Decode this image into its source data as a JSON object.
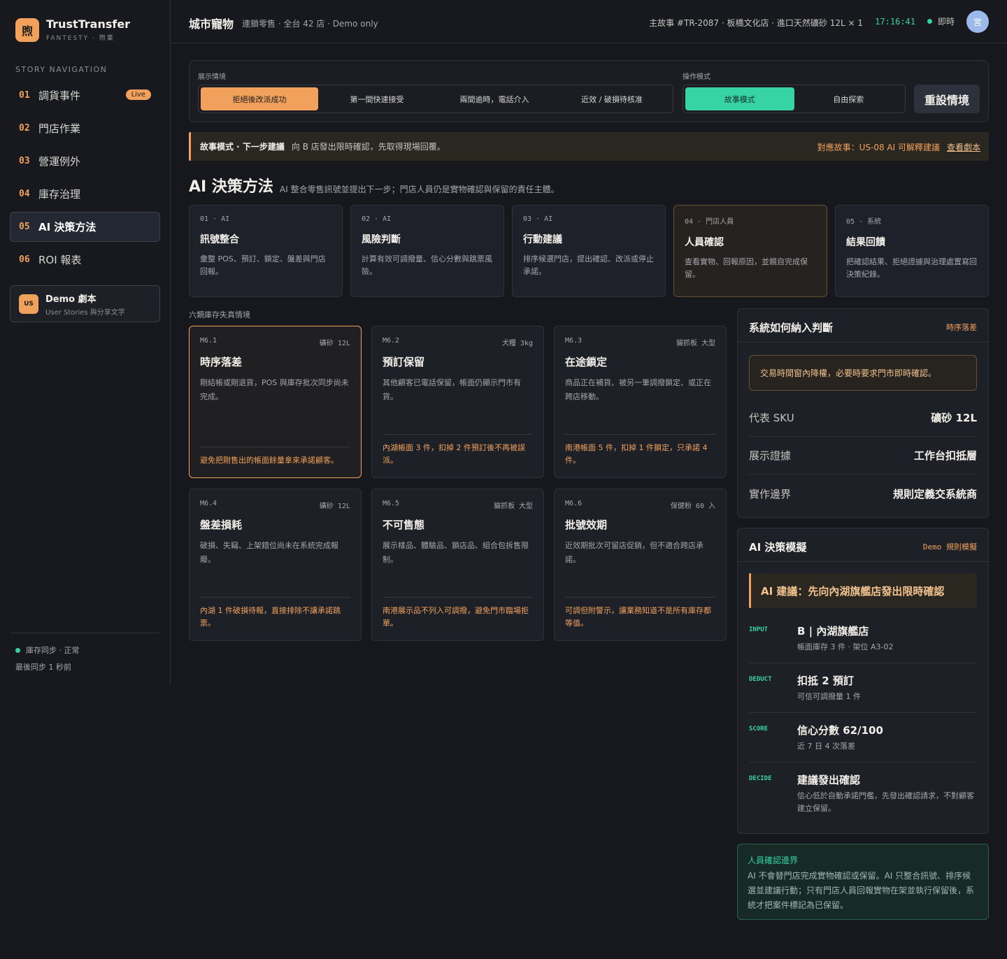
{
  "brand": {
    "logo_char": "煦",
    "name": "TrustTransfer",
    "sub": "FANTESTY · 煦業"
  },
  "nav": {
    "heading": "STORY NAVIGATION",
    "items": [
      {
        "num": "01",
        "label": "調貨事件",
        "badge": "Live"
      },
      {
        "num": "02",
        "label": "門店作業"
      },
      {
        "num": "03",
        "label": "營運例外"
      },
      {
        "num": "04",
        "label": "庫存治理"
      },
      {
        "num": "05",
        "label": "AI 決策方法",
        "active": true
      },
      {
        "num": "06",
        "label": "ROI 報表"
      }
    ]
  },
  "demo_card": {
    "icon": "US",
    "title": "Demo 劇本",
    "sub": "User Stories 與分享文字"
  },
  "sync": {
    "status": "庫存同步 · 正常",
    "last": "最後同步 1 秒前"
  },
  "header": {
    "title": "城市寵物",
    "sub": "連鎖零售 · 全台 42 店 · Demo only",
    "story": "主故事 #TR-2087 · 板橋文化店 · 進口天然礦砂 12L × 1",
    "time": "17:16:41",
    "live": "即時",
    "avatar": "宮"
  },
  "control": {
    "scenario_label": "展示情境",
    "scenarios": [
      "拒絕後改派成功",
      "第一間快速接受",
      "兩間逾時，電話介入",
      "近效 / 破損待核准"
    ],
    "mode_label": "操作模式",
    "modes": [
      "故事模式",
      "自由探索"
    ],
    "reset": "重設情境"
  },
  "banner": {
    "strong": "故事模式 · 下一步建議",
    "text": "向 B 店發出限時確認，先取得現場回覆。",
    "right": "對應故事：US-08 AI 可解釋建議",
    "link": "查看劇本"
  },
  "section": {
    "title": "AI 決策方法",
    "sub": "AI 整合零售訊號並提出下一步；門店人員仍是實物確認與保留的責任主體。"
  },
  "steps": [
    {
      "tag": "01 · AI",
      "title": "訊號整合",
      "desc": "彙整 POS、預訂、鎖定、盤差與門店回報。"
    },
    {
      "tag": "02 · AI",
      "title": "風險判斷",
      "desc": "計算有效可調撥量、信心分數與跳票風險。"
    },
    {
      "tag": "03 · AI",
      "title": "行動建議",
      "desc": "排序候選門店，提出確認、改派或停止承諾。"
    },
    {
      "tag": "04 · 門店人員",
      "title": "人員確認",
      "desc": "查看實物、回報原因，並親自完成保留。"
    },
    {
      "tag": "05 · 系統",
      "title": "結果回饋",
      "desc": "把確認結果、拒絕證據與治理處置寫回決策紀錄。"
    }
  ],
  "six_label": "六類庫存失真情境",
  "scenarios": [
    {
      "code": "M6.1",
      "meta": "礦砂 12L",
      "title": "時序落差",
      "desc": "剛結帳或剛退貨，POS 與庫存批次同步尚未完成。",
      "foot": "避免把剛售出的帳面餘量拿來承諾顧客。"
    },
    {
      "code": "M6.2",
      "meta": "犬糧 3kg",
      "title": "預訂保留",
      "desc": "其他顧客已電話保留，帳面仍顯示門市有貨。",
      "foot": "內湖帳面 3 件，扣掉 2 件預訂後不再被誤派。"
    },
    {
      "code": "M6.3",
      "meta": "貓抓板 大型",
      "title": "在途鎖定",
      "desc": "商品正在補貨、被另一筆調撥鎖定、或正在跨店移動。",
      "foot": "南港帳面 5 件，扣掉 1 件鎖定，只承諾 4 件。"
    },
    {
      "code": "M6.4",
      "meta": "礦砂 12L",
      "title": "盤差損耗",
      "desc": "破損、失竊、上架錯位尚未在系統完成報廢。",
      "foot": "內湖 1 件破損待報，直接排除不讓承諾跳票。"
    },
    {
      "code": "M6.5",
      "meta": "貓抓板 大型",
      "title": "不可售態",
      "desc": "展示樣品、體驗品、鎖店品、組合包拆售限制。",
      "foot": "南港展示品不列入可調撥，避免門市臨場拒單。"
    },
    {
      "code": "M6.6",
      "meta": "保健粉 60 入",
      "title": "批號效期",
      "desc": "近效期批次可留店促銷，但不適合跨店承諾。",
      "foot": "可調但附警示，讓業務知道不是所有庫存都等值。"
    }
  ],
  "judge": {
    "title": "系統如何納入判斷",
    "tag": "時序落差",
    "notice": "交易時間窗內降權，必要時要求門市即時確認。",
    "rows": [
      {
        "k": "代表 SKU",
        "v": "礦砂 12L"
      },
      {
        "k": "展示證據",
        "v": "工作台扣抵層"
      },
      {
        "k": "實作邊界",
        "v": "規則定義交系統商"
      }
    ]
  },
  "sim": {
    "title": "AI 決策模擬",
    "tag": "Demo 規則模擬",
    "advice": "AI 建議：先向內湖旗艦店發出限時確認",
    "rows": [
      {
        "key": "INPUT",
        "title": "B | 內湖旗艦店",
        "sub": "帳面庫存 3 件 · 架位 A3-02"
      },
      {
        "key": "DEDUCT",
        "title": "扣抵 2 預訂",
        "sub": "可信可調撥量 1 件"
      },
      {
        "key": "SCORE",
        "title": "信心分數 62/100",
        "sub": "近 7 日 4 次落差"
      },
      {
        "key": "DECIDE",
        "title": "建議發出確認",
        "sub": "信心低於自動承諾門檻，先發出確認請求，不對顧客建立保留。"
      }
    ]
  },
  "boundary": {
    "title": "人員確認邊界",
    "text": "AI 不會替門店完成實物確認或保留。AI 只整合訊號、排序候選並建議行動；只有門店人員回報實物在架並執行保留後，系統才把案件標記為已保留。"
  }
}
